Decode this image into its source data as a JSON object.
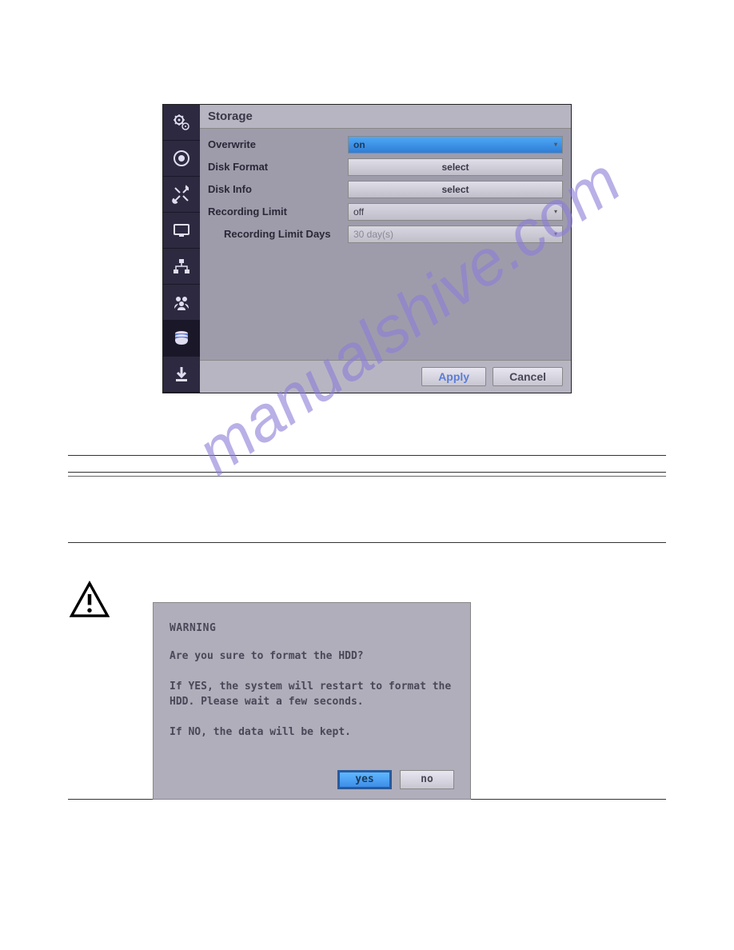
{
  "watermark": "manualshive.com",
  "panel": {
    "title": "Storage",
    "rows": {
      "overwrite": {
        "label": "Overwrite",
        "value": "on"
      },
      "disk_format": {
        "label": "Disk Format",
        "button": "select"
      },
      "disk_info": {
        "label": "Disk Info",
        "button": "select"
      },
      "recording_limit": {
        "label": "Recording Limit",
        "value": "off"
      },
      "recording_limit_days": {
        "label": "Recording Limit Days",
        "value": "30 day(s)"
      }
    },
    "footer": {
      "apply": "Apply",
      "cancel": "Cancel"
    }
  },
  "sidebar": {
    "items": [
      {
        "name": "settings-icon"
      },
      {
        "name": "record-icon"
      },
      {
        "name": "tools-icon"
      },
      {
        "name": "display-icon"
      },
      {
        "name": "network-icon"
      },
      {
        "name": "users-icon"
      },
      {
        "name": "storage-icon"
      },
      {
        "name": "download-icon"
      }
    ]
  },
  "warning": {
    "title": "WARNING",
    "line1": "Are you sure to format the HDD?",
    "line2": "If YES, the system will restart to format the HDD. Please wait a few seconds.",
    "line3": "If NO, the data will be kept.",
    "yes": "yes",
    "no": "no"
  }
}
